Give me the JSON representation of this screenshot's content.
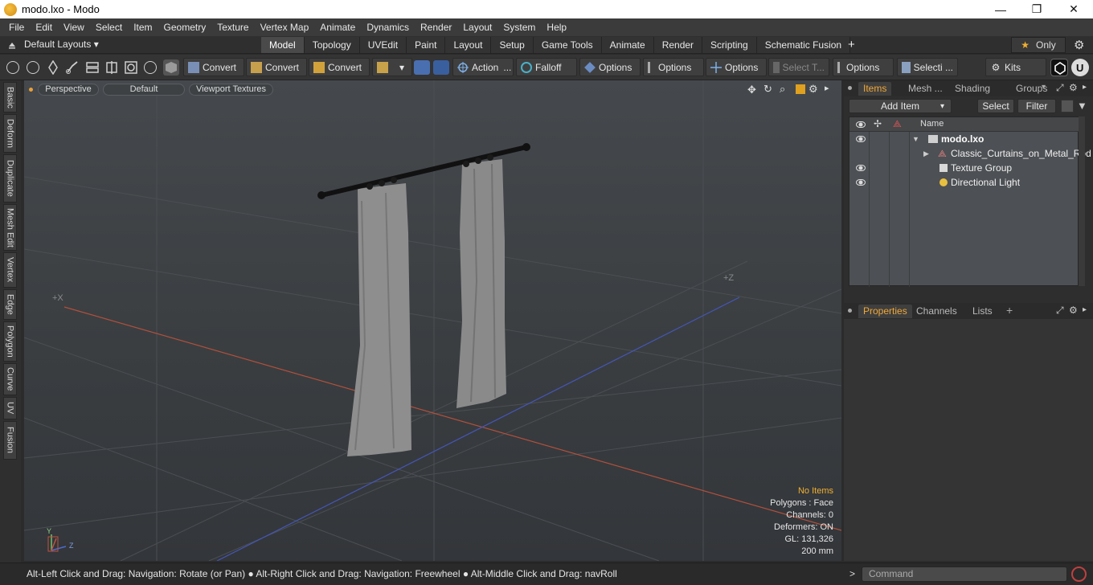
{
  "window": {
    "title": "modo.lxo - Modo",
    "minimize": "—",
    "maximize": "❐",
    "close": "✕"
  },
  "menu": [
    "File",
    "Edit",
    "View",
    "Select",
    "Item",
    "Geometry",
    "Texture",
    "Vertex Map",
    "Animate",
    "Dynamics",
    "Render",
    "Layout",
    "System",
    "Help"
  ],
  "layoutbar": {
    "default_layouts": "Default Layouts ▾",
    "only_label": "Only",
    "tabs": [
      "Model",
      "Topology",
      "UVEdit",
      "Paint",
      "Layout",
      "Setup",
      "Game Tools",
      "Animate",
      "Render",
      "Scripting",
      "Schematic Fusion"
    ],
    "active_tab": "Model",
    "add_tab": "+"
  },
  "toolbar": {
    "convert1": "Convert",
    "convert2": "Convert",
    "convert3": "Convert",
    "action": "Action",
    "falloff": "Falloff",
    "options1": "Options",
    "options2": "Options",
    "options3": "Options",
    "select_t": "Select T...",
    "options4": "Options",
    "selecti": "Selecti ...",
    "kits": "Kits"
  },
  "left_tabs": [
    "Basic",
    "Deform",
    "Duplicate",
    "Mesh Edit",
    "Vertex",
    "Edge",
    "Polygon",
    "Curve",
    "UV",
    "Fusion"
  ],
  "viewport": {
    "view_mode": "Perspective",
    "shading": "Default",
    "textures": "Viewport Textures",
    "axis_x": "+X",
    "axis_z": "+Z",
    "info": {
      "items": "No Items",
      "polygons": "Polygons : Face",
      "channels": "Channels: 0",
      "deformers": "Deformers: ON",
      "gl": "GL: 131,326",
      "scale": "200 mm"
    }
  },
  "items_panel": {
    "tabs": [
      "Items",
      "Mesh ...",
      "Shading",
      "Groups"
    ],
    "add_item": "Add Item",
    "select": "Select",
    "filter": "Filter",
    "column_name": "Name",
    "tree": [
      {
        "label": "modo.lxo"
      },
      {
        "label": "Classic_Curtains_on_Metal_Rod"
      },
      {
        "label": "Texture Group"
      },
      {
        "label": "Directional Light"
      }
    ]
  },
  "props_panel": {
    "tabs": [
      "Properties",
      "Channels",
      "Lists"
    ],
    "add": "+"
  },
  "status": {
    "hint": "Alt-Left Click and Drag: Navigation: Rotate (or Pan) ● Alt-Right Click and Drag: Navigation: Freewheel ● Alt-Middle Click and Drag: navRoll",
    "command_placeholder": "Command",
    "prompt": ">"
  },
  "colors": {
    "accent": "#f0a838",
    "x_axis": "#c0533f",
    "z_axis": "#4a5bc4",
    "curtain": "#8d8d8d"
  }
}
